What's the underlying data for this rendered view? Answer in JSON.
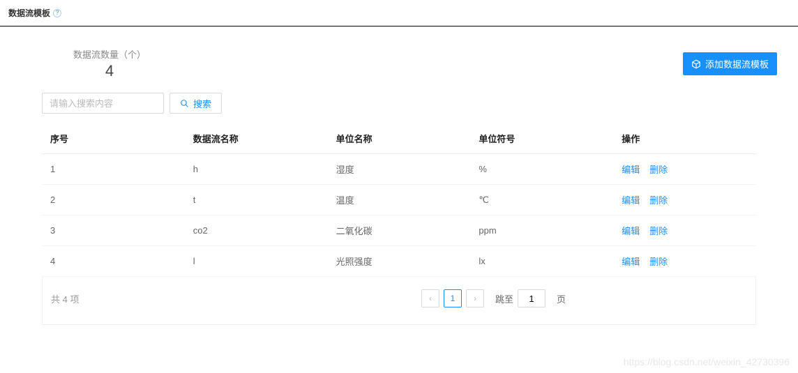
{
  "header": {
    "title": "数据流模板"
  },
  "summary": {
    "label": "数据流数量（个）",
    "value": "4"
  },
  "actions": {
    "add_template": "添加数据流模板"
  },
  "search": {
    "placeholder": "请输入搜索内容",
    "button_label": "搜索"
  },
  "table": {
    "columns": {
      "index": "序号",
      "name": "数据流名称",
      "unit_name": "单位名称",
      "unit_symbol": "单位符号",
      "action": "操作"
    },
    "rows": [
      {
        "index": "1",
        "name": "h",
        "unit_name": "湿度",
        "unit_symbol": "%"
      },
      {
        "index": "2",
        "name": "t",
        "unit_name": "温度",
        "unit_symbol": "℃"
      },
      {
        "index": "3",
        "name": "co2",
        "unit_name": "二氧化碳",
        "unit_symbol": "ppm"
      },
      {
        "index": "4",
        "name": "l",
        "unit_name": "光照强度",
        "unit_symbol": "lx"
      }
    ],
    "action_edit": "编辑",
    "action_delete": "删除"
  },
  "pagination": {
    "total_text": "共 4 项",
    "current_page": "1",
    "jump_label": "跳至",
    "jump_value": "1",
    "page_suffix": "页"
  },
  "watermark": "https://blog.csdn.net/weixin_42730396"
}
